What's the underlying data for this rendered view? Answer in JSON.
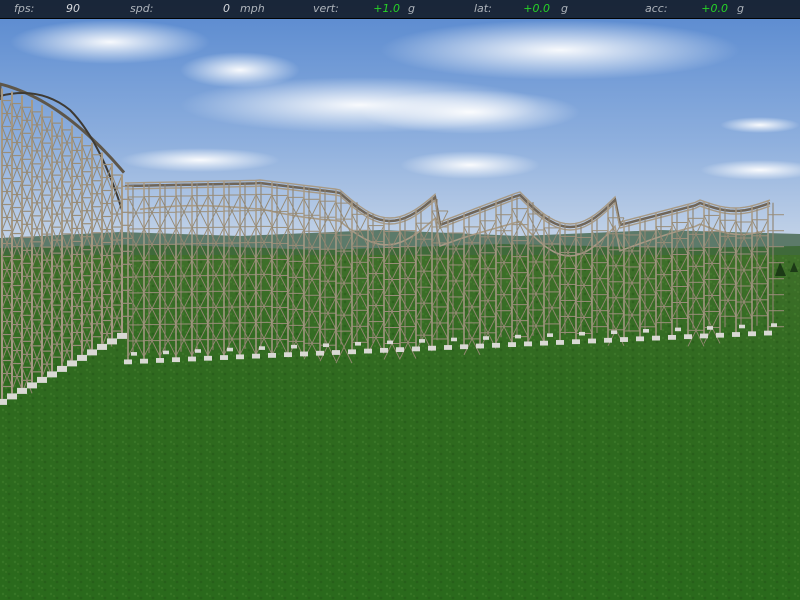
{
  "hud": {
    "fps_label": "fps:",
    "fps_value": "90",
    "spd_label": "spd:",
    "spd_value": "0",
    "spd_unit": "mph",
    "vert_label": "vert:",
    "vert_value": "+1.0",
    "vert_unit": "g",
    "lat_label": "lat:",
    "lat_value": "+0.0",
    "lat_unit": "g",
    "acc_label": "acc:",
    "acc_value": "+0.0",
    "acc_unit": "g"
  },
  "colors": {
    "hud_background": "#0a0c10",
    "hud_label": "#aeb4bb",
    "hud_value_positive": "#27d427",
    "sky_top": "#5d8fd3",
    "sky_horizon": "#b8cde8",
    "grass": "#2f6b1e",
    "wood": "#a79a86"
  },
  "scene": {
    "description_icon": "wooden-roller-coaster-scene"
  }
}
